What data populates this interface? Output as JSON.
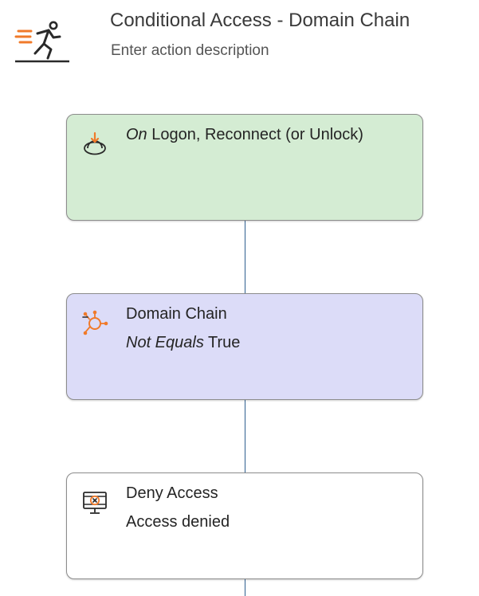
{
  "header": {
    "title": "Conditional Access - Domain Chain",
    "description": "Enter action description",
    "icon": "running-person-icon"
  },
  "flow": {
    "trigger": {
      "icon": "logon-trigger-icon",
      "prefix": "On",
      "label": "Logon, Reconnect (or Unlock)",
      "background": "#d4ecd3"
    },
    "condition": {
      "icon": "network-hub-icon",
      "label": "Domain Chain",
      "operator": "Not Equals",
      "value": "True",
      "background": "#dcdcf8"
    },
    "action": {
      "icon": "deny-access-icon",
      "label": "Deny Access",
      "detail": "Access denied",
      "background": "#ffffff"
    }
  },
  "colors": {
    "accent_orange": "#f07a2a",
    "connector": "#2f5f8f"
  }
}
